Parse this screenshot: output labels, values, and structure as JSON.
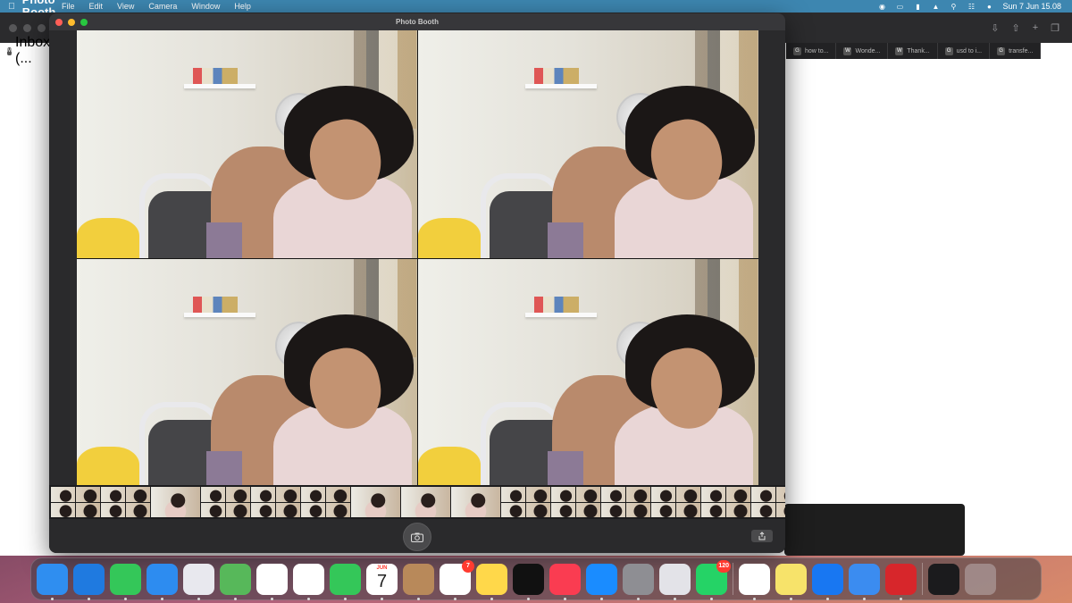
{
  "menubar": {
    "app_name": "Photo Booth",
    "menus": [
      "File",
      "Edit",
      "View",
      "Camera",
      "Window",
      "Help"
    ],
    "clock": "Sun 7 Jun  15.08"
  },
  "browser": {
    "first_tab": "Inbox (...",
    "tabs": [
      {
        "label": "how to...",
        "icon": "google-icon"
      },
      {
        "label": "Wonde...",
        "icon": "wondershare-icon"
      },
      {
        "label": "Thank...",
        "icon": "w-icon"
      },
      {
        "label": "usd to i...",
        "icon": "google-icon"
      },
      {
        "label": "transfe...",
        "icon": "google-icon"
      }
    ]
  },
  "photobooth": {
    "title": "Photo Booth",
    "tiles": 4,
    "filmstrip": [
      "quad",
      "quad",
      "single",
      "quad",
      "quad",
      "quad",
      "single",
      "single",
      "single",
      "quad",
      "quad",
      "quad",
      "quad",
      "quad",
      "quad",
      "quad",
      "quad",
      "quad",
      "quad",
      "quad",
      "quad",
      "quad",
      "quad",
      "quad",
      "quad",
      "quad",
      "quad",
      "quad",
      "quad",
      "quad",
      "quad",
      "quad",
      "quad",
      "quad",
      "quad",
      "quad",
      "quad",
      "quad",
      "quad",
      "quad",
      "quad",
      "quad",
      "quad",
      "quad",
      "quad",
      "quad",
      "quad",
      "quad",
      "selected"
    ]
  },
  "dock": {
    "calendar_month": "JUN",
    "calendar_day": "7",
    "reminders_badge": "7",
    "whatsapp_badge": "120",
    "apps": [
      {
        "name": "finder-icon",
        "color": "#2f8ef0"
      },
      {
        "name": "safari-icon",
        "color": "#1f7ae0"
      },
      {
        "name": "messages-icon",
        "color": "#34c759"
      },
      {
        "name": "mail-icon",
        "color": "#2d8cf0"
      },
      {
        "name": "launchpad-icon",
        "color": "#e8e8ee"
      },
      {
        "name": "maps-icon",
        "color": "#57b85a"
      },
      {
        "name": "photos-icon",
        "color": "#ffffff"
      },
      {
        "name": "freeform-icon",
        "color": "#ffffff"
      },
      {
        "name": "facetime-icon",
        "color": "#34c759"
      },
      {
        "name": "calendar-icon",
        "color": "#ffffff"
      },
      {
        "name": "contacts-icon",
        "color": "#b8895a"
      },
      {
        "name": "reminders-icon",
        "color": "#ffffff"
      },
      {
        "name": "notes-icon",
        "color": "#ffd84a"
      },
      {
        "name": "appletv-icon",
        "color": "#111111"
      },
      {
        "name": "music-icon",
        "color": "#fa3c51"
      },
      {
        "name": "appstore-icon",
        "color": "#1a8cff"
      },
      {
        "name": "system-settings-icon",
        "color": "#8e8e93"
      },
      {
        "name": "iphone-mirroring-icon",
        "color": "#e3e3e8"
      },
      {
        "name": "whatsapp-icon",
        "color": "#25d366"
      }
    ],
    "apps_right": [
      {
        "name": "chrome-icon",
        "color": "#ffffff"
      },
      {
        "name": "stickies-icon",
        "color": "#f7e36a"
      },
      {
        "name": "add-app-icon",
        "color": "#1877f2"
      },
      {
        "name": "file-transfer-icon",
        "color": "#3b8cf0"
      },
      {
        "name": "photo-booth-icon",
        "color": "#d7262b"
      }
    ]
  }
}
